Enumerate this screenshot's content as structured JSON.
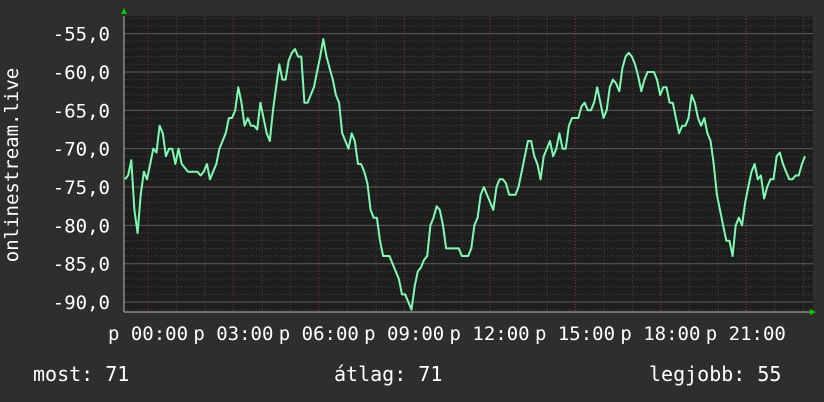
{
  "chart_data": {
    "type": "line",
    "ylabel": "onlinestream.live",
    "ylim": [
      -91.3,
      -52.7
    ],
    "y_ticks": [
      "-55,0",
      "-60,0",
      "-65,0",
      "-70,0",
      "-75,0",
      "-80,0",
      "-85,0",
      "-90,0"
    ],
    "y_tick_values": [
      -55,
      -60,
      -65,
      -70,
      -75,
      -80,
      -85,
      -90
    ],
    "x_tick_labels": [
      "p 00:00",
      "p 03:00",
      "p 06:00",
      "p 09:00",
      "p 12:00",
      "p 15:00",
      "p 18:00",
      "p 21:00"
    ],
    "grid": true,
    "colors": {
      "background": "#2e2e2e",
      "plot": "#1e1e1e",
      "line": "#7dfbb0",
      "grid": "#555555",
      "axis_marker": "#00cc00"
    },
    "series": [
      {
        "values": [
          -74,
          -73.5,
          -71.5,
          -78,
          -81,
          -76,
          -73,
          -74,
          -72,
          -70,
          -70.5,
          -67,
          -68,
          -71,
          -70,
          -70,
          -72,
          -70,
          -72,
          -72.5,
          -73,
          -73,
          -73,
          -73,
          -73.5,
          -73,
          -72,
          -74,
          -73,
          -72,
          -70,
          -69,
          -68,
          -66,
          -66,
          -65,
          -62,
          -64,
          -67,
          -66,
          -67,
          -67,
          -67.5,
          -64,
          -66,
          -68,
          -69,
          -65,
          -62,
          -59,
          -61,
          -61,
          -58.5,
          -57.5,
          -57,
          -58,
          -58,
          -64,
          -64,
          -63,
          -62,
          -60,
          -58,
          -55.7,
          -58,
          -59.5,
          -61,
          -63,
          -64,
          -68,
          -69,
          -70,
          -68,
          -69,
          -72,
          -72,
          -73,
          -74.5,
          -78,
          -79,
          -79,
          -82,
          -84,
          -84,
          -84,
          -85,
          -86,
          -87,
          -89,
          -89,
          -90,
          -91,
          -88,
          -86,
          -85.5,
          -84.5,
          -84,
          -80,
          -79,
          -77.5,
          -78,
          -80,
          -83,
          -83,
          -83,
          -83,
          -83,
          -84,
          -84,
          -84,
          -83,
          -80,
          -79,
          -76,
          -75,
          -76,
          -77,
          -78,
          -75,
          -74,
          -74,
          -74.5,
          -76,
          -76,
          -76,
          -75,
          -73,
          -71,
          -69,
          -69,
          -71,
          -72,
          -74,
          -71,
          -70,
          -69,
          -71,
          -70,
          -68,
          -70,
          -70,
          -67,
          -66,
          -66,
          -66,
          -64.5,
          -64,
          -65,
          -65,
          -64,
          -62,
          -64,
          -66,
          -65,
          -62,
          -61,
          -61.5,
          -62.5,
          -59.5,
          -58,
          -57.5,
          -58,
          -59,
          -60.5,
          -62.5,
          -61,
          -60,
          -60,
          -60,
          -61,
          -63,
          -62,
          -62,
          -64,
          -64,
          -66,
          -68,
          -67,
          -67,
          -66,
          -63,
          -64,
          -66,
          -67,
          -66,
          -68,
          -69,
          -72,
          -76,
          -78,
          -80,
          -82,
          -82,
          -84,
          -80,
          -79,
          -80,
          -77,
          -75,
          -73,
          -72,
          -74,
          -73.5,
          -76.5,
          -75,
          -74,
          -74,
          -71,
          -70.5,
          -72,
          -73,
          -74,
          -74,
          -73.5,
          -73.5,
          -72,
          -71
        ]
      }
    ]
  },
  "stats": {
    "now": "most: 71",
    "avg": "átlag: 71",
    "max": "legjobb: 55"
  }
}
